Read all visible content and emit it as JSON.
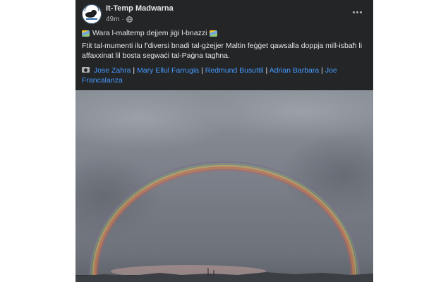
{
  "post": {
    "page_name": "It-Temp Madwarna",
    "time": "49m",
    "separator": "·",
    "more_label": "More options",
    "title": "Wara l-maltemp dejjem jiġi l-bnazzi",
    "body": "Ftit tal-mumenti ilu f'diversi bnadi tal-gżejjer Maltin feġġet qawsalla doppja mill-isbaħ li affaxxinat lil bosta segwaċi tal-Paġna tagħna.",
    "credits": [
      {
        "name": "Jose Zahra"
      },
      {
        "name": "Mary Ellul Farrugia"
      },
      {
        "name": "Redmund Busuttil"
      },
      {
        "name": "Adrian Barbara"
      },
      {
        "name": "Joe Francalanza"
      }
    ],
    "credit_separator": "|",
    "icons": {
      "avatar": "cloud-logo-icon",
      "privacy": "globe-icon",
      "title_emoji": "rainbow-icon",
      "credits": "camera-icon",
      "more": "ellipsis-icon"
    },
    "colors": {
      "card_bg": "#242526",
      "text": "#e4e6eb",
      "muted": "#b0b3b8",
      "link": "#4599ff"
    }
  }
}
